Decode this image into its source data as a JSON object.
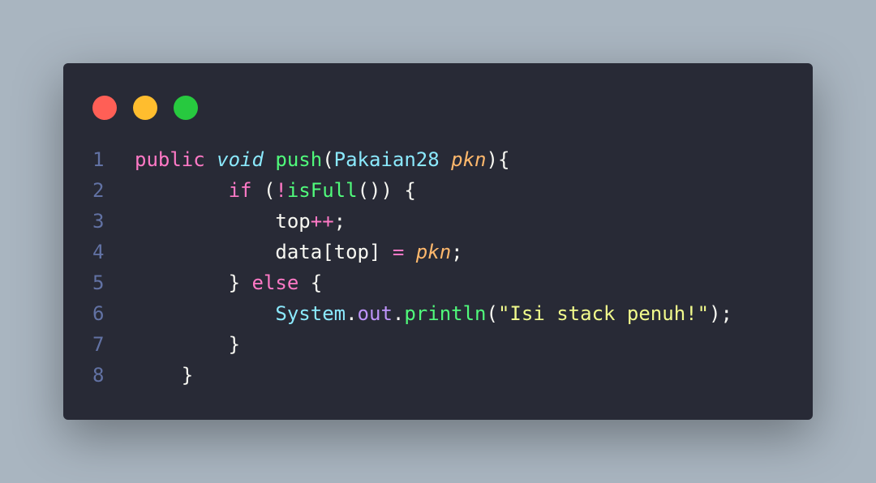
{
  "colors": {
    "background": "#a9b5c0",
    "window": "#282a36",
    "close": "#ff5f56",
    "minimize": "#ffbd2e",
    "maximize": "#27c93f",
    "default": "#f8f8f2",
    "keyword": "#ff79c6",
    "type": "#8be9fd",
    "function": "#50fa7b",
    "param": "#ffb86c",
    "string": "#f1fa8c",
    "field": "#bd93f9",
    "line_number": "#6272a4"
  },
  "editor": {
    "lines": [
      {
        "number": "1",
        "tokens": [
          {
            "text": "public ",
            "kind": "keyword"
          },
          {
            "text": "void",
            "kind": "type",
            "italic": true
          },
          {
            "text": " ",
            "kind": "default"
          },
          {
            "text": "push",
            "kind": "function"
          },
          {
            "text": "(",
            "kind": "default"
          },
          {
            "text": "Pakaian28",
            "kind": "type"
          },
          {
            "text": " ",
            "kind": "default"
          },
          {
            "text": "pkn",
            "kind": "param",
            "italic": true
          },
          {
            "text": "){",
            "kind": "default"
          }
        ]
      },
      {
        "number": "2",
        "tokens": [
          {
            "text": "        ",
            "kind": "default"
          },
          {
            "text": "if",
            "kind": "keyword"
          },
          {
            "text": " (",
            "kind": "default"
          },
          {
            "text": "!",
            "kind": "keyword"
          },
          {
            "text": "isFull",
            "kind": "function"
          },
          {
            "text": "()) {",
            "kind": "default"
          }
        ]
      },
      {
        "number": "3",
        "tokens": [
          {
            "text": "            top",
            "kind": "default"
          },
          {
            "text": "++",
            "kind": "keyword"
          },
          {
            "text": ";",
            "kind": "default"
          }
        ]
      },
      {
        "number": "4",
        "tokens": [
          {
            "text": "            data[top] ",
            "kind": "default"
          },
          {
            "text": "=",
            "kind": "keyword"
          },
          {
            "text": " ",
            "kind": "default"
          },
          {
            "text": "pkn",
            "kind": "param",
            "italic": true
          },
          {
            "text": ";",
            "kind": "default"
          }
        ]
      },
      {
        "number": "5",
        "tokens": [
          {
            "text": "        } ",
            "kind": "default"
          },
          {
            "text": "else",
            "kind": "keyword"
          },
          {
            "text": " {",
            "kind": "default"
          }
        ]
      },
      {
        "number": "6",
        "tokens": [
          {
            "text": "            ",
            "kind": "default"
          },
          {
            "text": "System",
            "kind": "type"
          },
          {
            "text": ".",
            "kind": "default"
          },
          {
            "text": "out",
            "kind": "field"
          },
          {
            "text": ".",
            "kind": "default"
          },
          {
            "text": "println",
            "kind": "function"
          },
          {
            "text": "(",
            "kind": "default"
          },
          {
            "text": "\"Isi stack penuh!\"",
            "kind": "string"
          },
          {
            "text": ");",
            "kind": "default"
          }
        ]
      },
      {
        "number": "7",
        "tokens": [
          {
            "text": "        }",
            "kind": "default"
          }
        ]
      },
      {
        "number": "8",
        "tokens": [
          {
            "text": "    }",
            "kind": "default"
          }
        ]
      }
    ]
  }
}
